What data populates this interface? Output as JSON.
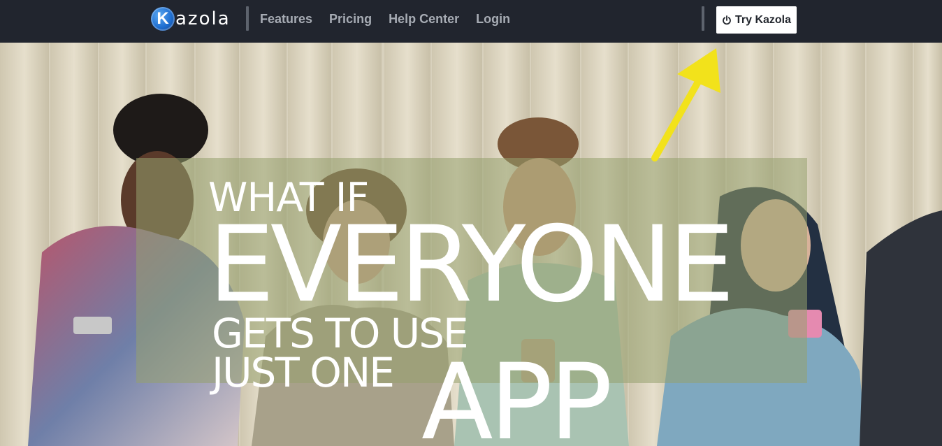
{
  "nav": {
    "logo_letter": "K",
    "logo_text": "azola",
    "links": [
      "Features",
      "Pricing",
      "Help Center",
      "Login"
    ],
    "cta_label": "Try Kazola",
    "cta_icon": "power-icon"
  },
  "hero": {
    "line1": "WHAT IF",
    "line2": "EVERYONE",
    "line3": "GETS TO USE",
    "line4": "JUST ONE",
    "line5": "APP"
  },
  "colors": {
    "nav_bg": "#21252e",
    "arrow": "#f2e21b",
    "cta_bg": "#ffffff"
  }
}
